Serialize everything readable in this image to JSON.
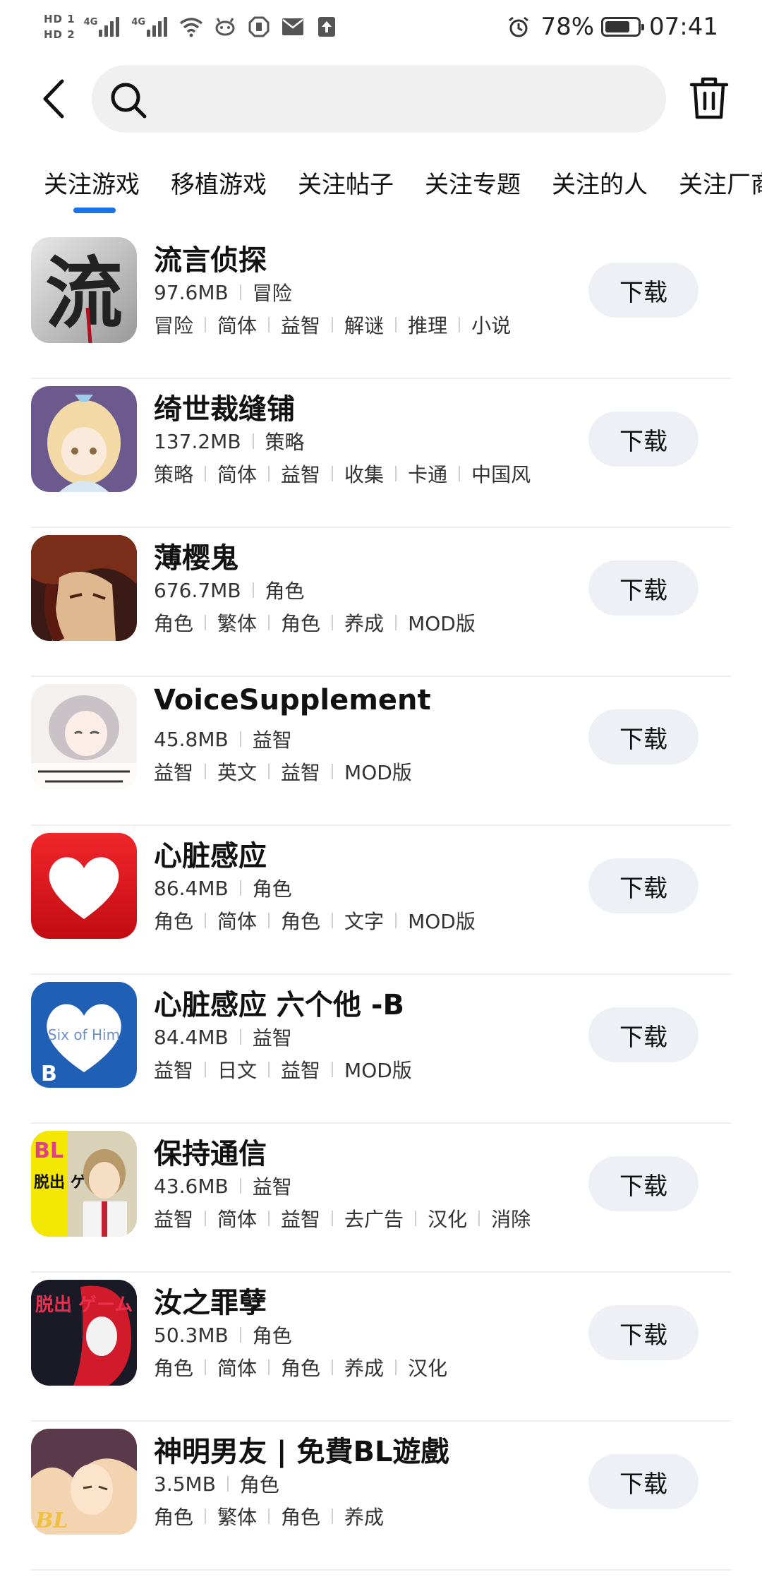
{
  "status_bar": {
    "hd1": "HD 1",
    "hd2": "HD 2",
    "sig1_label": "4G",
    "sig2_label": "4G",
    "battery_text": "78%",
    "battery_level": 0.78,
    "time": "07:41"
  },
  "search": {
    "value": "",
    "placeholder": ""
  },
  "tabs": [
    {
      "label": "关注游戏",
      "active": true
    },
    {
      "label": "移植游戏"
    },
    {
      "label": "关注帖子"
    },
    {
      "label": "关注专题"
    },
    {
      "label": "关注的人"
    },
    {
      "label": "关注厂商"
    }
  ],
  "items": [
    {
      "title": "流言侦探",
      "size": "97.6MB",
      "category": "冒险",
      "tags": [
        "冒险",
        "简体",
        "益智",
        "解谜",
        "推理",
        "小说"
      ],
      "button": "下载",
      "icon_name": "liuyan-game-icon",
      "icon_text": "流",
      "icon_colors": [
        "#e8e8e8",
        "#9a9a9a"
      ]
    },
    {
      "title": "绮世裁缝铺",
      "size": "137.2MB",
      "category": "策略",
      "tags": [
        "策略",
        "简体",
        "益智",
        "收集",
        "卡通",
        "中国风"
      ],
      "button": "下载",
      "icon_name": "tailor-game-icon",
      "icon_text": "",
      "icon_colors": [
        "#6c5a8e",
        "#f2d9a6"
      ]
    },
    {
      "title": "薄樱鬼",
      "size": "676.7MB",
      "category": "角色",
      "tags": [
        "角色",
        "繁体",
        "角色",
        "养成",
        "MOD版"
      ],
      "button": "下载",
      "icon_name": "hakuoki-game-icon",
      "icon_text": "",
      "icon_colors": [
        "#7a2e1a",
        "#e0b890"
      ]
    },
    {
      "title": "VoiceSupplement",
      "size": "45.8MB",
      "category": "益智",
      "tags": [
        "益智",
        "英文",
        "益智",
        "MOD版"
      ],
      "button": "下载",
      "icon_name": "voice-supplement-icon",
      "icon_text": "",
      "icon_colors": [
        "#f4f0ee",
        "#c9c2c6"
      ]
    },
    {
      "title": "心脏感应",
      "size": "86.4MB",
      "category": "角色",
      "tags": [
        "角色",
        "简体",
        "角色",
        "文字",
        "MOD版"
      ],
      "button": "下载",
      "icon_name": "heart-game-icon",
      "icon_text": "",
      "icon_colors": [
        "#e4171c",
        "#ffffff"
      ]
    },
    {
      "title": "心脏感应 六个他 -B",
      "size": "84.4MB",
      "category": "益智",
      "tags": [
        "益智",
        "日文",
        "益智",
        "MOD版"
      ],
      "button": "下载",
      "icon_name": "six-of-him-icon",
      "icon_text": "Six of Him",
      "icon_badge": "B",
      "icon_colors": [
        "#1f5fb5",
        "#ffffff"
      ]
    },
    {
      "title": "保持通信",
      "size": "43.6MB",
      "category": "益智",
      "tags": [
        "益智",
        "简体",
        "益智",
        "去广告",
        "汉化",
        "消除"
      ],
      "button": "下载",
      "icon_name": "keep-contact-icon",
      "icon_text": "BL",
      "icon_subtext": "脱出 ゲーム",
      "icon_colors": [
        "#f3e600",
        "#e0408a"
      ]
    },
    {
      "title": "汝之罪孽",
      "size": "50.3MB",
      "category": "角色",
      "tags": [
        "角色",
        "简体",
        "角色",
        "养成",
        "汉化"
      ],
      "button": "下载",
      "icon_name": "sin-game-icon",
      "icon_text": "脱出 ゲーム",
      "icon_colors": [
        "#1a1a26",
        "#d11a2a"
      ]
    },
    {
      "title": "神明男友 | 免費BL遊戲",
      "size": "3.5MB",
      "category": "角色",
      "tags": [
        "角色",
        "繁体",
        "角色",
        "养成"
      ],
      "button": "下载",
      "icon_name": "god-boyfriend-icon",
      "icon_text": "BL",
      "icon_colors": [
        "#5a3a4a",
        "#f0c040"
      ]
    }
  ]
}
